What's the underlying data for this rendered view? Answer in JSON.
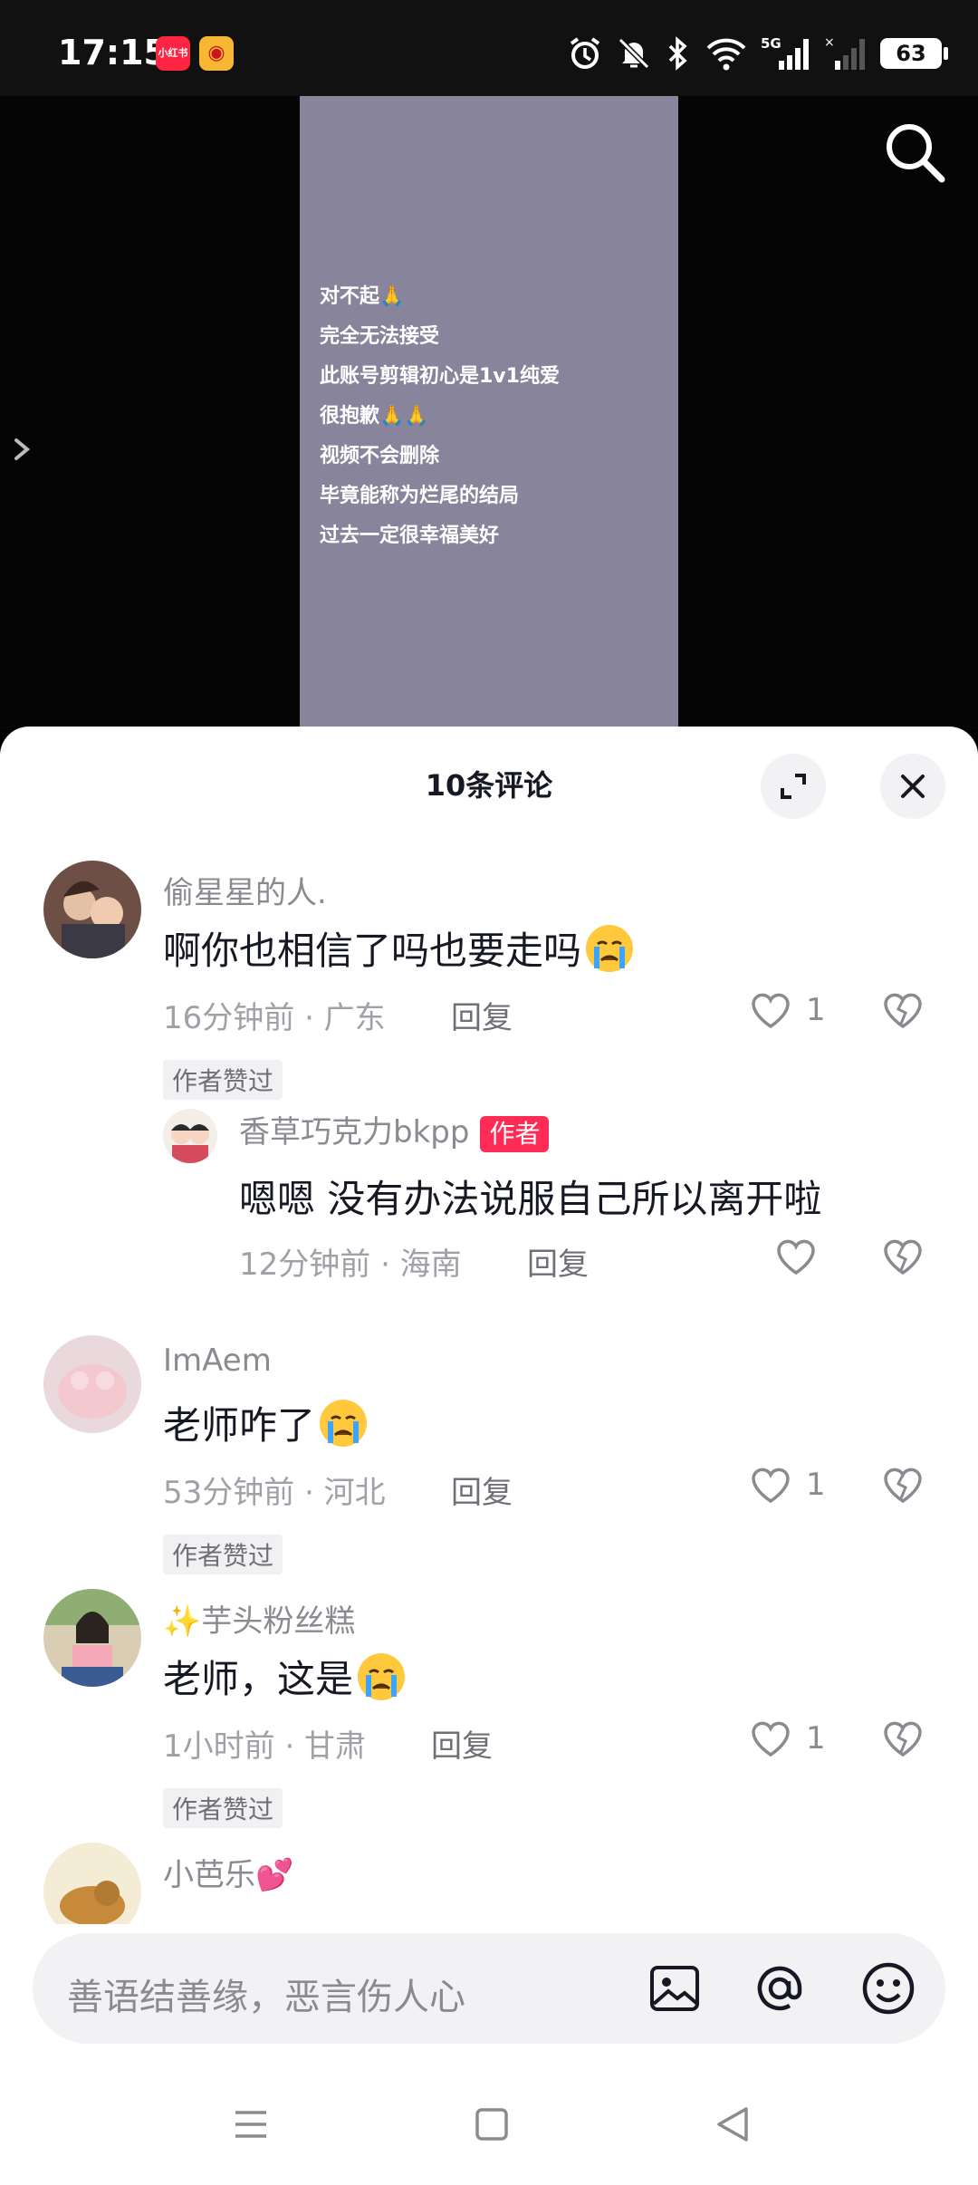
{
  "status_bar": {
    "time": "17:15",
    "app_icons": [
      "xiaohongshu-icon",
      "weibo-icon"
    ],
    "app_labels": {
      "xiaohongshu": "小红书"
    },
    "network": "5G",
    "battery": "63"
  },
  "video": {
    "lines": [
      "对不起🙏",
      "完全无法接受",
      "此账号剪辑初心是1v1纯爱",
      "很抱歉🙏🙏",
      "视频不会删除",
      "毕竟能称为烂尾的结局",
      "过去一定很幸福美好"
    ]
  },
  "sheet": {
    "title": "10条评论"
  },
  "comments": [
    {
      "user": "偷星星的人.",
      "text": "啊你也相信了吗也要走吗",
      "meta": "16分钟前 · 广东",
      "reply": "回复",
      "likes": "1",
      "liked_by_author": "作者赞过",
      "sub_reply": {
        "user": "香草巧克力bkpp",
        "badge": "作者",
        "text": "嗯嗯 没有办法说服自己所以离开啦",
        "meta": "12分钟前 · 海南",
        "reply": "回复"
      }
    },
    {
      "user": "ImAem",
      "text": "老师咋了",
      "meta": "53分钟前 · 河北",
      "reply": "回复",
      "likes": "1",
      "liked_by_author": "作者赞过"
    },
    {
      "user": "✨芋头粉丝糕",
      "text": "老师，这是",
      "meta": "1小时前 · 甘肃",
      "reply": "回复",
      "likes": "1",
      "liked_by_author": "作者赞过"
    },
    {
      "user": "小芭乐💕"
    }
  ],
  "input": {
    "placeholder": "善语结善缘，恶言伤人心"
  },
  "colors": {
    "accent": "#fe2c55",
    "video_panel": "#87849b",
    "muted_text": "#8a8b91"
  }
}
